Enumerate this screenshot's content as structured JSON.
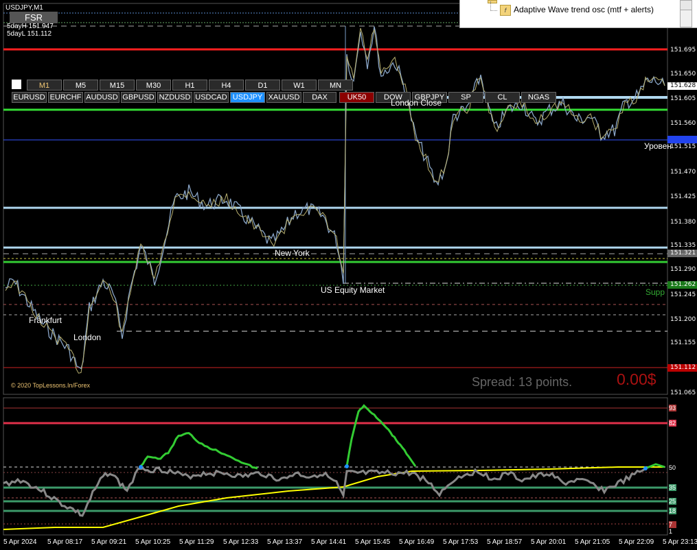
{
  "window": {
    "title": "USDJPY,M1"
  },
  "fsr_button": "FSR",
  "five_day": {
    "high": "5dayH 151.947",
    "low": "5dayL 151.112"
  },
  "timeframes": [
    "M1",
    "M5",
    "M15",
    "M30",
    "H1",
    "H4",
    "D1",
    "W1",
    "MN"
  ],
  "symbols": [
    "EURUSD",
    "EURCHF",
    "AUDUSD",
    "GBPUSD",
    "NZDUSD",
    "USDCAD",
    "USDJPY",
    "XAUUSD",
    "DAX",
    "UK50",
    "DOW",
    "GBPJPY",
    "SP",
    "CL",
    "NGAS"
  ],
  "active_symbol": "USDJPY",
  "session_labels": {
    "london_close": "London Close",
    "new_york": "New York",
    "us_equity": "US Equity Market",
    "frankfurt": "Frankfurt",
    "london": "London",
    "uroven": "Уровен",
    "support": "Supp"
  },
  "copyright": "© 2020 TopLessons.In/Forex",
  "spread": "Spread: 13 points.",
  "profit": "0.00$",
  "price_axis": [
    {
      "label": "151.695"
    },
    {
      "label": "151.650"
    },
    {
      "label": "151.628",
      "current": true
    },
    {
      "label": "151.605"
    },
    {
      "label": "151.560"
    },
    {
      "label": "151.515"
    },
    {
      "label": "151.470"
    },
    {
      "label": "151.425"
    },
    {
      "label": "151.380"
    },
    {
      "label": "151.335"
    },
    {
      "label": "151.321",
      "tag": "gray"
    },
    {
      "label": "151.290"
    },
    {
      "label": "151.262",
      "tag": "green"
    },
    {
      "label": "151.245"
    },
    {
      "label": "151.200"
    },
    {
      "label": "151.155"
    },
    {
      "label": "151.112",
      "tag": "red"
    },
    {
      "label": "151.065"
    }
  ],
  "osc_axis": [
    "93",
    "82",
    "50",
    "35",
    "25",
    "18",
    "7",
    "1"
  ],
  "time_axis": [
    "5 Apr 2024",
    "5 Apr 08:17",
    "5 Apr 09:21",
    "5 Apr 10:25",
    "5 Apr 11:29",
    "5 Apr 12:33",
    "5 Apr 13:37",
    "5 Apr 14:41",
    "5 Apr 15:45",
    "5 Apr 16:49",
    "5 Apr 17:53",
    "5 Apr 18:57",
    "5 Apr 20:01",
    "5 Apr 21:05",
    "5 Apr 22:09",
    "5 Apr 23:13"
  ],
  "popup": {
    "item": "Adaptive Wave trend osc (mtf + alerts)"
  },
  "colors": {
    "red_line": "#ff0000",
    "green_line": "#33cc33",
    "lightblue_line": "#b0d8f0",
    "price_line": "#7a9ec7",
    "osc_gray": "#888888",
    "osc_green": "#33cc33",
    "osc_yellow": "#ffff00",
    "osc_blue": "#1e90ff"
  }
}
